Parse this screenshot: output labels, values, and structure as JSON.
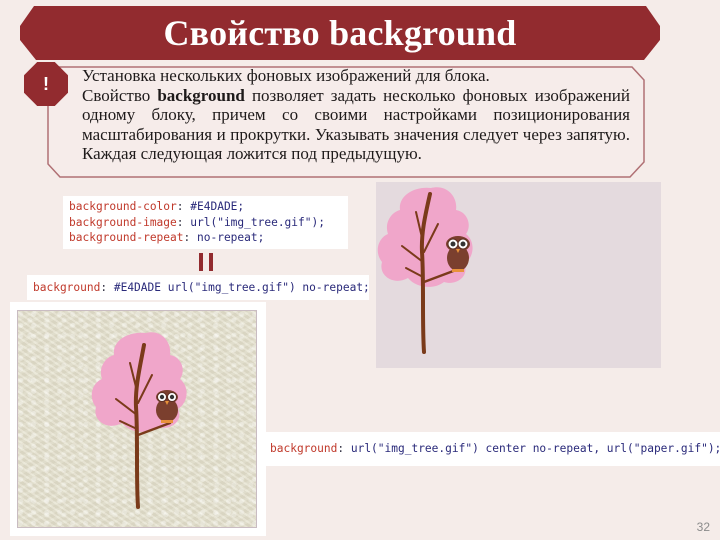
{
  "title": "Свойство background",
  "note": {
    "badge": "!",
    "heading": "Установка нескольких фоновых изображений для блока.",
    "body_prefix": "Свойство ",
    "body_keyword": "background",
    "body_suffix": " позволяет задать несколько фоновых изображений одному блоку, причем со своими настройками позиционирования масштабирования и прокрутки. Указывать значения следует через запятую. Каждая следующая ложится под предыдущую."
  },
  "code_longhand": [
    {
      "prop": "background-color",
      "value": "#E4DADE;"
    },
    {
      "prop": "background-image",
      "value": "url(\"img_tree.gif\");"
    },
    {
      "prop": "background-repeat",
      "value": "no-repeat;"
    }
  ],
  "code_shorthand": {
    "prop": "background",
    "value": "#E4DADE url(\"img_tree.gif\") no-repeat;"
  },
  "code_multiple": {
    "prop": "background",
    "value": "url(\"img_tree.gif\") center no-repeat, url(\"paper.gif\");"
  },
  "equals_symbol": "||",
  "demo_colors": {
    "background_color": "#E4DADE",
    "paper_color": "#E4E0CC",
    "foliage": "#F0A6CA",
    "trunk": "#7A3A1A",
    "owl_body": "#7B3F2E",
    "accent": "#922B2F"
  },
  "page_number": "32"
}
